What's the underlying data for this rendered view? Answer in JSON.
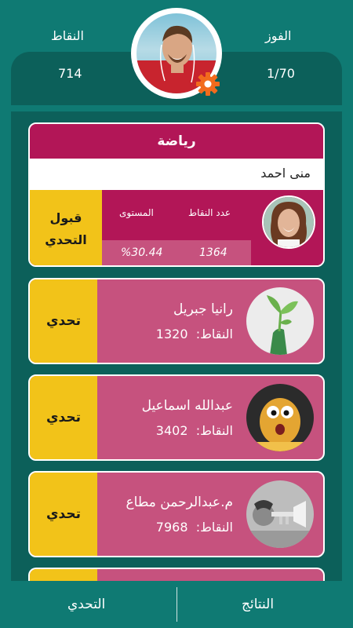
{
  "header": {
    "points_label": "النقاط",
    "points_value": "714",
    "wins_label": "الفوز",
    "wins_value": "1/70"
  },
  "featured": {
    "category": "رياضة",
    "name": "منى احمد",
    "accept_label_line1": "قبول",
    "accept_label_line2": "التحدي",
    "points_col_label": "عدد النقاط",
    "level_col_label": "المستوى",
    "points_value": "1364",
    "level_value": "%30.44"
  },
  "players": [
    {
      "name": "رانيا جبريل",
      "points_label": "النقاط:",
      "points": "1320",
      "action": "تحدي",
      "avatar_icon": "plant-hand-avatar"
    },
    {
      "name": "عبدالله اسماعيل",
      "points_label": "النقاط:",
      "points": "3402",
      "action": "تحدي",
      "avatar_icon": "potato-character-avatar"
    },
    {
      "name": "م.عبدالرحمن مطاع",
      "points_label": "النقاط:",
      "points": "7968",
      "action": "تحدي",
      "avatar_icon": "trumpet-player-avatar"
    }
  ],
  "bottom_nav": {
    "results_label": "النتائج",
    "challenge_label": "التحدي"
  },
  "colors": {
    "teal": "#0f7a73",
    "dark_teal": "#0c605a",
    "magenta": "#b21657",
    "pink": "#c6527e",
    "yellow": "#f2c319",
    "gear_orange": "#f26b1d"
  }
}
